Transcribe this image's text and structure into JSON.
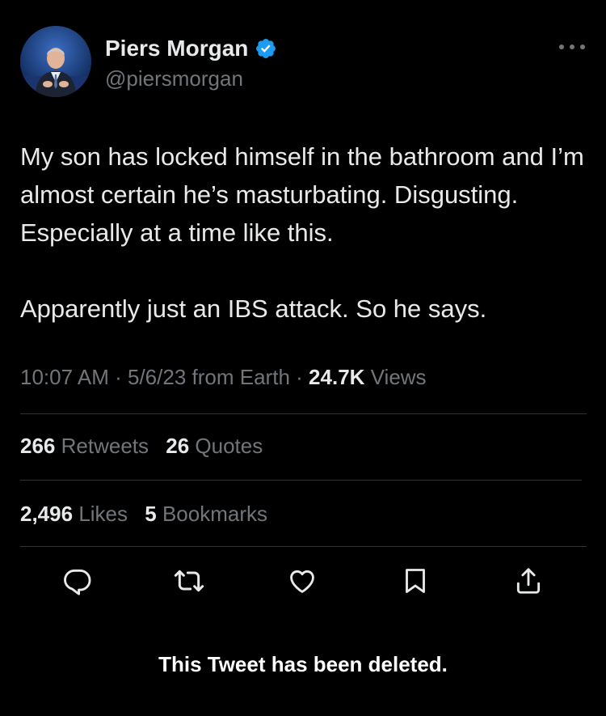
{
  "author": {
    "name": "Piers Morgan",
    "handle": "@piersmorgan",
    "verified_icon": "verified-badge-icon"
  },
  "tweet": {
    "paragraphs": [
      "My son has locked himself in the bathroom and I’m almost certain he’s masturbating. Disgusting. Especially at a time like this.",
      "Apparently just an IBS attack. So he says."
    ],
    "time": "10:07 AM",
    "date": "5/6/23",
    "source": "from Earth",
    "views_count": "24.7K",
    "views_label": "Views",
    "separator": "·"
  },
  "stats": {
    "retweets_count": "266",
    "retweets_label": "Retweets",
    "quotes_count": "26",
    "quotes_label": "Quotes",
    "likes_count": "2,496",
    "likes_label": "Likes",
    "bookmarks_count": "5",
    "bookmarks_label": "Bookmarks"
  },
  "actions": [
    "reply-icon",
    "retweet-icon",
    "like-icon",
    "bookmark-icon",
    "share-icon"
  ],
  "notice": "This Tweet has been deleted.",
  "colors": {
    "background": "#000000",
    "text": "#e7e9ea",
    "secondary": "#71767b",
    "divider": "#2f3336",
    "verified": "#1d9bf0"
  }
}
